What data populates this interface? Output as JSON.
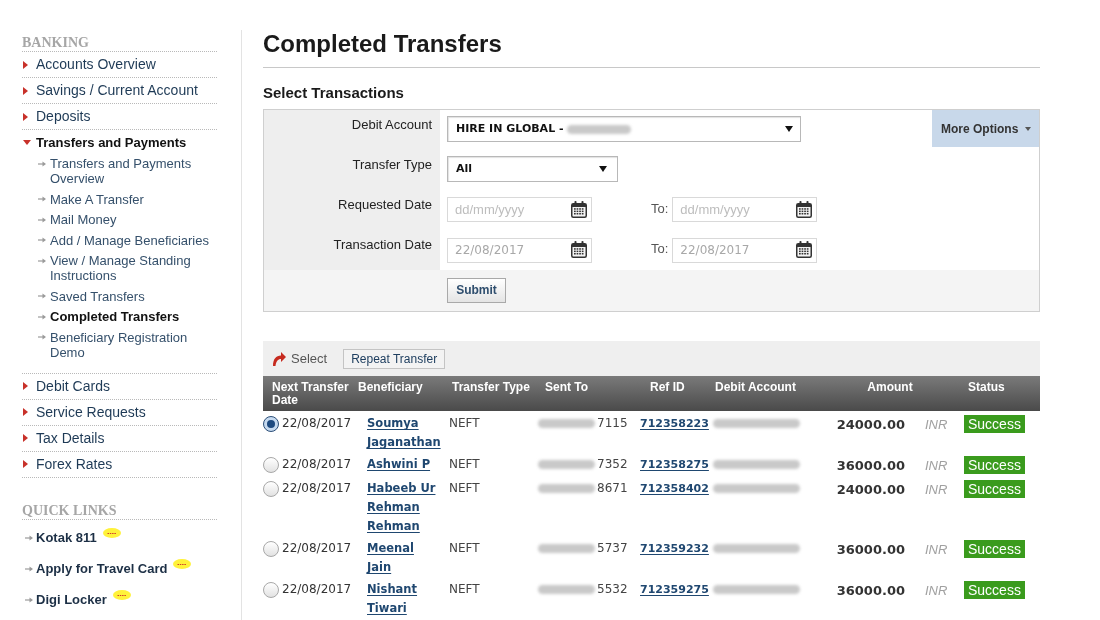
{
  "sidebar": {
    "banking": {
      "heading": "BANKING",
      "items": [
        {
          "label": "Accounts Overview",
          "expanded": false
        },
        {
          "label": "Savings / Current Account",
          "expanded": false
        },
        {
          "label": "Deposits",
          "expanded": false
        },
        {
          "label": "Transfers and Payments",
          "expanded": true,
          "children": [
            {
              "label": "Transfers and Payments Overview",
              "selected": false
            },
            {
              "label": "Make A Transfer",
              "selected": false
            },
            {
              "label": "Mail Money",
              "selected": false
            },
            {
              "label": "Add / Manage Beneficiaries",
              "selected": false
            },
            {
              "label": "View / Manage Standing Instructions",
              "selected": false
            },
            {
              "label": "Saved Transfers",
              "selected": false
            },
            {
              "label": "Completed Transfers",
              "selected": true
            },
            {
              "label": "Beneficiary Registration Demo",
              "selected": false
            }
          ]
        },
        {
          "label": "Debit Cards",
          "expanded": false
        },
        {
          "label": "Service Requests",
          "expanded": false
        },
        {
          "label": "Tax Details",
          "expanded": false
        },
        {
          "label": "Forex Rates",
          "expanded": false
        }
      ]
    },
    "quick_links": {
      "heading": "QUICK LINKS",
      "items": [
        {
          "label": "Kotak 811",
          "new": true
        },
        {
          "label": "Apply for Travel Card",
          "new": true
        },
        {
          "label": "Digi Locker",
          "new": true
        }
      ]
    }
  },
  "header": {
    "title": "Completed Transfers"
  },
  "filters": {
    "heading": "Select Transactions",
    "debit_account": {
      "label": "Debit Account",
      "value": "HIRE IN GLOBAL -"
    },
    "transfer_type": {
      "label": "Transfer Type",
      "value": "All"
    },
    "requested_date": {
      "label": "Requested Date",
      "from": {
        "placeholder": "dd/mm/yyyy"
      },
      "to_label": "To:",
      "to": {
        "placeholder": "dd/mm/yyyy"
      }
    },
    "transaction_date": {
      "label": "Transaction Date",
      "from": {
        "value": "22/08/2017",
        "disabled": true
      },
      "to_label": "To:",
      "to": {
        "value": "22/08/2017",
        "disabled": true
      }
    },
    "more_options": "More Options",
    "submit": "Submit"
  },
  "toolbar": {
    "select_label": "Select",
    "repeat_button": "Repeat Transfer"
  },
  "table": {
    "columns": [
      "Next Transfer Date",
      "Beneficiary",
      "Transfer Type",
      "Sent To",
      "Ref ID",
      "Debit Account",
      "Amount",
      "Status"
    ],
    "rows": [
      {
        "selected": true,
        "date": "22/08/2017",
        "beneficiary": "Soumya Jaganathan",
        "transfer_type": "NEFT",
        "sent_to": "7115",
        "ref_id": "712358223",
        "amount": "24000.00",
        "currency": "INR",
        "status": "Success"
      },
      {
        "selected": false,
        "date": "22/08/2017",
        "beneficiary": "Ashwini P",
        "transfer_type": "NEFT",
        "sent_to": "7352",
        "ref_id": "712358275",
        "amount": "36000.00",
        "currency": "INR",
        "status": "Success"
      },
      {
        "selected": false,
        "date": "22/08/2017",
        "beneficiary": "Habeeb Ur Rehman Rehman",
        "transfer_type": "NEFT",
        "sent_to": "8671",
        "ref_id": "712358402",
        "amount": "24000.00",
        "currency": "INR",
        "status": "Success"
      },
      {
        "selected": false,
        "date": "22/08/2017",
        "beneficiary": "Meenal Jain",
        "transfer_type": "NEFT",
        "sent_to": "5737",
        "ref_id": "712359232",
        "amount": "36000.00",
        "currency": "INR",
        "status": "Success"
      },
      {
        "selected": false,
        "date": "22/08/2017",
        "beneficiary": "Nishant Tiwari",
        "transfer_type": "NEFT",
        "sent_to": "5532",
        "ref_id": "712359275",
        "amount": "36000.00",
        "currency": "INR",
        "status": "Success"
      }
    ]
  }
}
